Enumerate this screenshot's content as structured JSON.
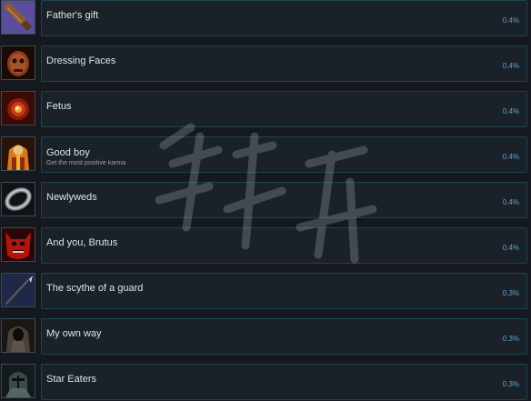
{
  "achievements": [
    {
      "title": "Father's gift",
      "description": "",
      "percent": "0.4%",
      "icon": "club-weapon-icon"
    },
    {
      "title": "Dressing Faces",
      "description": "",
      "percent": "0.4%",
      "icon": "flayed-face-icon"
    },
    {
      "title": "Fetus",
      "description": "",
      "percent": "0.4%",
      "icon": "fetus-orb-icon"
    },
    {
      "title": "Good boy",
      "description": "Get the most positive karma",
      "percent": "0.4%",
      "icon": "monk-figure-icon"
    },
    {
      "title": "Newlyweds",
      "description": "",
      "percent": "0.4%",
      "icon": "wedding-ring-icon"
    },
    {
      "title": "And you, Brutus",
      "description": "",
      "percent": "0.4%",
      "icon": "red-demon-mask-icon"
    },
    {
      "title": "The scythe of a guard",
      "description": "",
      "percent": "0.3%",
      "icon": "spear-icon"
    },
    {
      "title": "My own way",
      "description": "",
      "percent": "0.3%",
      "icon": "hooded-figure-icon"
    },
    {
      "title": "Star Eaters",
      "description": "",
      "percent": "0.3%",
      "icon": "armored-knight-icon"
    }
  ],
  "colors": {
    "background": "#15191f",
    "bar": "#1b2129",
    "bar_border": "#1c4550",
    "title": "#dfe3e6",
    "percent": "#5aa5d4"
  }
}
